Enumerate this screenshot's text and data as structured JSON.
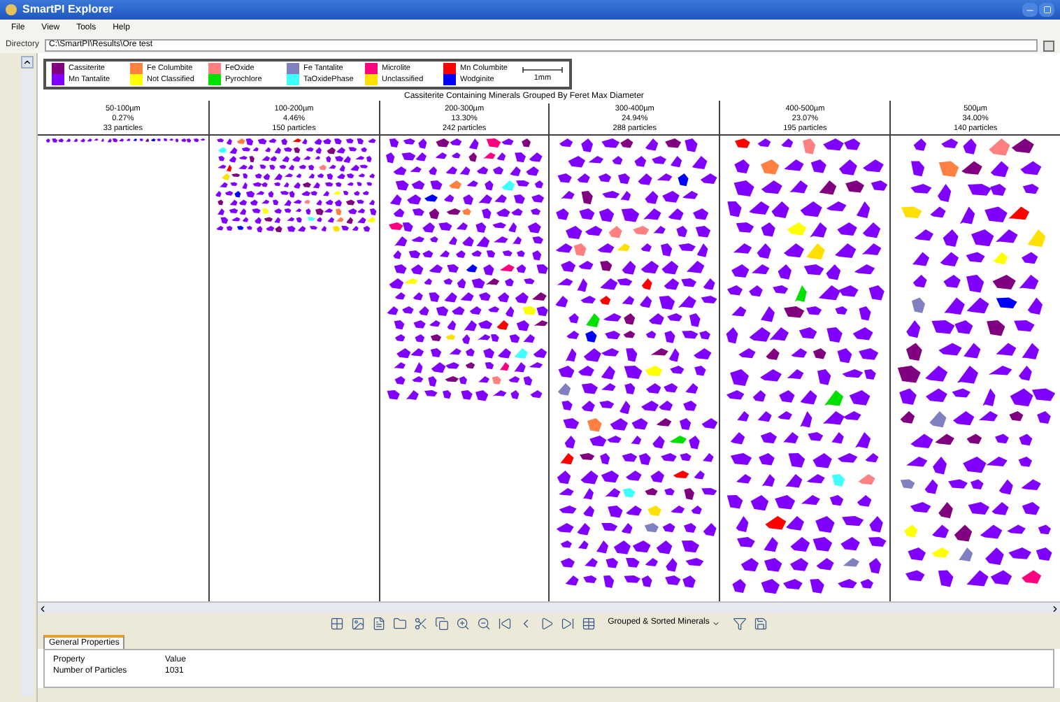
{
  "window": {
    "title": "SmartPI Explorer"
  },
  "menu": [
    "File",
    "View",
    "Tools",
    "Help"
  ],
  "directory": {
    "label": "Directory",
    "value": "C:\\SmartPI\\Results\\Ore test"
  },
  "legend": {
    "items": [
      {
        "name": "Cassiterite",
        "color": "#800080"
      },
      {
        "name": "Mn Tantalite",
        "color": "#8000ff"
      },
      {
        "name": "Fe Columbite",
        "color": "#ff8040"
      },
      {
        "name": "Not Classified",
        "color": "#ffff00"
      },
      {
        "name": "FeOxide",
        "color": "#ff8080"
      },
      {
        "name": "Pyrochlore",
        "color": "#00e000"
      },
      {
        "name": "Fe Tantalite",
        "color": "#8080c0"
      },
      {
        "name": "TaOxidePhase",
        "color": "#40ffff"
      },
      {
        "name": "Microlite",
        "color": "#ff0080"
      },
      {
        "name": "Unclassified",
        "color": "#ffe000"
      },
      {
        "name": "Mn Columbite",
        "color": "#ff0000"
      },
      {
        "name": "Wodginite",
        "color": "#0000ff"
      }
    ],
    "scale_label": "1mm"
  },
  "chart_title": "Cassiterite Containing Minerals Grouped By Feret Max Diameter",
  "columns": [
    {
      "range": "50-100µm",
      "percent": "0.27%",
      "count": "33 particles"
    },
    {
      "range": "100-200µm",
      "percent": "4.46%",
      "count": "150 particles"
    },
    {
      "range": "200-300µm",
      "percent": "13.30%",
      "count": "242 particles"
    },
    {
      "range": "300-400µm",
      "percent": "24.94%",
      "count": "288 particles"
    },
    {
      "range": "400-500µm",
      "percent": "23.07%",
      "count": "195 particles"
    },
    {
      "range": "500µm",
      "percent": "34.00%",
      "count": "140 particles"
    }
  ],
  "toolbar": {
    "dropdown": "Grouped & Sorted Minerals"
  },
  "tabs": [
    {
      "label": "General Properties",
      "selected": true
    }
  ],
  "properties": {
    "columns": [
      "Property",
      "Value"
    ],
    "rows": [
      [
        "Number of Particles",
        "1031"
      ]
    ]
  }
}
